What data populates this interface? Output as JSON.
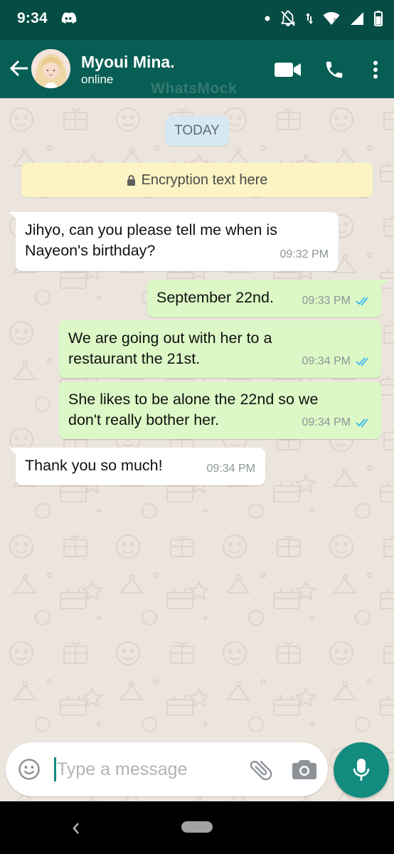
{
  "status_bar": {
    "time": "9:34",
    "icons": [
      "discord-icon",
      "notification-dot-icon",
      "mute-bell-icon",
      "data-arrows-icon",
      "wifi-icon",
      "cell-signal-icon",
      "battery-icon"
    ]
  },
  "header": {
    "contact_name": "Myoui Mina.",
    "contact_status": "online",
    "watermark": "WhatsMock",
    "icons": [
      "back-arrow-icon",
      "video-call-icon",
      "phone-icon",
      "more-vert-icon"
    ]
  },
  "chat": {
    "date_chip": "TODAY",
    "encryption_text": "Encryption text here",
    "messages": [
      {
        "direction": "in",
        "lines": [
          "Jihyo, can you please tell me when is",
          "Nayeon's birthday?"
        ],
        "time": "09:32 PM"
      },
      {
        "direction": "out",
        "lines": [
          "September 22nd."
        ],
        "time": "09:33 PM",
        "read": true
      },
      {
        "direction": "out",
        "lines": [
          "We are going out with her to a",
          "restaurant the 21st."
        ],
        "time": "09:34 PM",
        "read": true
      },
      {
        "direction": "out",
        "lines": [
          "She likes to be alone the 22nd so we",
          "don't really bother her."
        ],
        "time": "09:34 PM",
        "read": true
      },
      {
        "direction": "in",
        "lines": [
          "Thank you so much!"
        ],
        "time": "09:34 PM"
      }
    ]
  },
  "composer": {
    "placeholder": "Type a message",
    "value": ""
  },
  "colors": {
    "header": "#075e54",
    "status_bar": "#054d44",
    "outgoing_bubble": "#dcf8c6",
    "incoming_bubble": "#ffffff",
    "accent": "#128c7e",
    "read_tick": "#34b7f1",
    "chat_background": "#ece5dd"
  }
}
